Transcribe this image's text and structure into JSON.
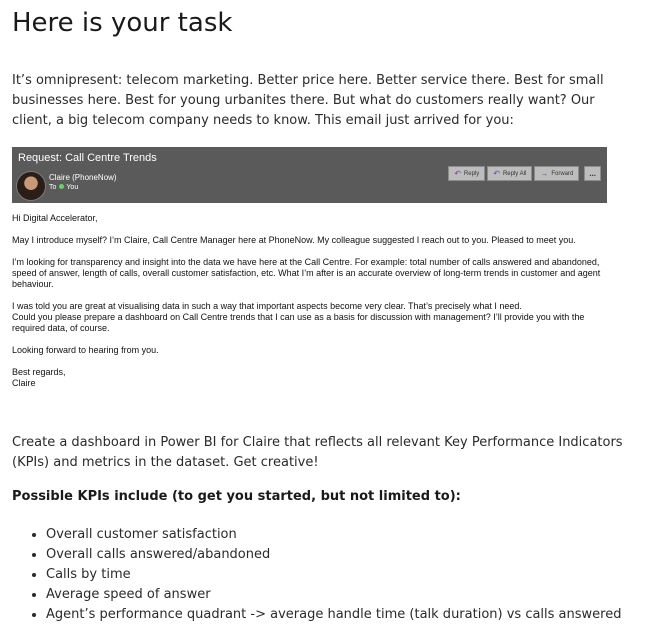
{
  "title": "Here is your task",
  "intro": "It’s omnipresent: telecom marketing. Better price here. Better service there. Best for small businesses here. Best for young urbanites there. But what do customers really want? Our client, a big telecom company needs to know. This email just arrived for you:",
  "email": {
    "subject": "Request: Call Centre Trends",
    "sender": "Claire (PhoneNow)",
    "to_label": "To",
    "recipient": "You",
    "actions": [
      "Reply",
      "Reply All",
      "Forward",
      "..."
    ],
    "greeting": "Hi Digital Accelerator,",
    "paragraphs": [
      "May I introduce myself? I’m Claire, Call Centre Manager here at PhoneNow. My colleague suggested I reach out to you. Pleased to meet you.",
      "I’m looking for transparency and insight into the data we have here at the Call Centre. For example: total number of calls answered and abandoned, speed of answer, length of calls, overall customer satisfaction, etc. What I’m after is an accurate overview of long-term trends in customer and agent behaviour.",
      "I was told you are great at visualising data in such a way that important aspects become very clear. That’s precisely what I need.",
      "Could you please prepare a dashboard on Call Centre trends that I can use as a basis for discussion with management? I’ll provide you with the required data, of course.",
      "Looking forward to hearing from you."
    ],
    "closing": "Best regards,",
    "signature": "Claire"
  },
  "task": "Create a dashboard in Power BI for Claire that reflects all relevant Key Performance Indicators (KPIs) and metrics in the dataset. Get creative!",
  "kpi_heading": "Possible KPIs include (to get you started, but not limited to):",
  "kpis": [
    "Overall customer satisfaction",
    "Overall calls answered/abandoned",
    "Calls by time",
    "Average speed of answer",
    "Agent’s performance quadrant -> average handle time (talk duration) vs calls answered"
  ]
}
